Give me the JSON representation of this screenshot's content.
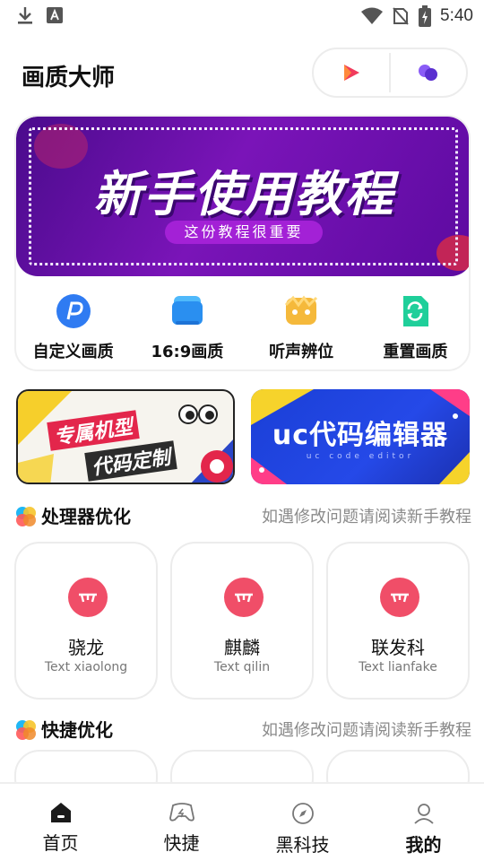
{
  "status_bar": {
    "time": "5:40",
    "icons": [
      "download-icon",
      "text-app-icon",
      "wifi-icon",
      "no-sim-icon",
      "battery-icon"
    ]
  },
  "header": {
    "title": "画质大师",
    "actions": [
      "play-icon",
      "dots-icon"
    ]
  },
  "banner": {
    "title": "新手使用教程",
    "subtitle": "这份教程很重要"
  },
  "quick_actions": [
    {
      "label": "自定义画质",
      "icon": "p-icon",
      "color": "#2f7bf2"
    },
    {
      "label": "16:9画质",
      "icon": "screen-icon",
      "color": "#2aa0f0"
    },
    {
      "label": "听声辨位",
      "icon": "mask-icon",
      "color": "#f5b93b"
    },
    {
      "label": "重置画质",
      "icon": "refresh-doc-icon",
      "color": "#1fcf9a"
    }
  ],
  "promos": {
    "left": {
      "line1": "专属机型",
      "line2": "代码定制"
    },
    "right": {
      "title": "uc代码编辑器",
      "subtitle": "uc code editor"
    }
  },
  "sections": {
    "processor": {
      "title": "处理器优化",
      "hint": "如遇修改问题请阅读新手教程"
    },
    "shortcut": {
      "title": "快捷优化",
      "hint": "如遇修改问题请阅读新手教程"
    }
  },
  "processors": [
    {
      "name": "骁龙",
      "sub": "Text xiaolong"
    },
    {
      "name": "麒麟",
      "sub": "Text qilin"
    },
    {
      "name": "联发科",
      "sub": "Text lianfake"
    }
  ],
  "bottom_nav": [
    {
      "label": "首页",
      "icon": "home-icon"
    },
    {
      "label": "快捷",
      "icon": "gamepad-icon"
    },
    {
      "label": "黑科技",
      "icon": "compass-icon"
    },
    {
      "label": "我的",
      "icon": "user-icon"
    }
  ],
  "colors": {
    "accent_red": "#f04e68",
    "banner_purple": "#7a14b8",
    "promo_blue": "#2549e8"
  }
}
